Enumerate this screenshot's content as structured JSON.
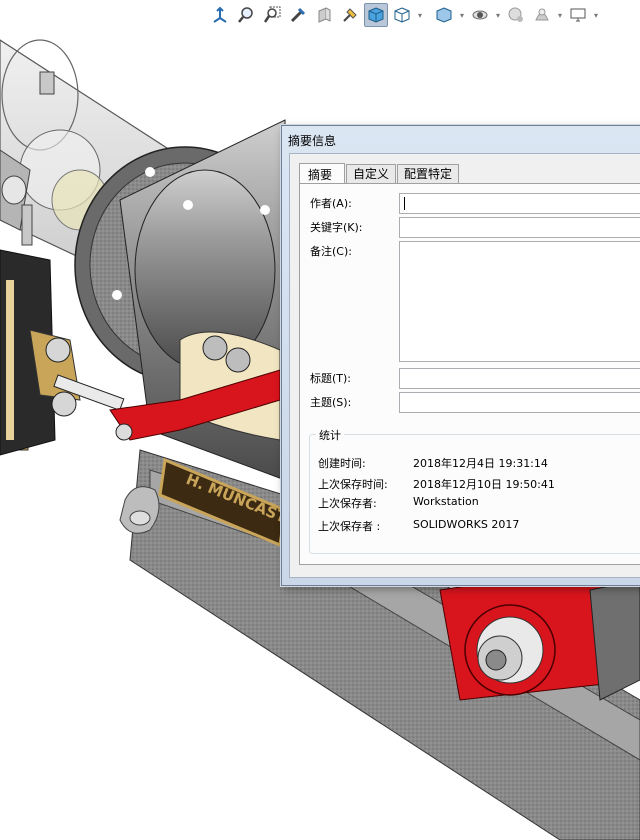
{
  "toolbar": {
    "buttons": [
      {
        "icon": "view-orientation-icon"
      },
      {
        "icon": "zoom-to-fit-icon"
      },
      {
        "icon": "zoom-to-area-icon"
      },
      {
        "icon": "previous-view-icon"
      },
      {
        "icon": "section-view-icon"
      },
      {
        "icon": "dynamic-annotation-icon"
      },
      {
        "icon": "shaded-display-icon",
        "active": true
      },
      {
        "icon": "display-style-icon"
      },
      {
        "icon": "hide-show-items-icon"
      },
      {
        "icon": "edit-appearance-icon"
      },
      {
        "icon": "apply-scene-icon"
      },
      {
        "icon": "view-settings-icon"
      },
      {
        "icon": "display-pane-icon"
      }
    ]
  },
  "dialog": {
    "title": "摘要信息",
    "tabs": [
      "摘要",
      "自定义",
      "配置特定"
    ],
    "active_tab": 0,
    "fields": {
      "author_label": "作者(A):",
      "author_value": "",
      "keywords_label": "关键字(K):",
      "keywords_value": "",
      "comments_label": "备注(C):",
      "comments_value": "",
      "title_label": "标题(T):",
      "title_value": "",
      "subject_label": "主题(S):",
      "subject_value": ""
    },
    "stats": {
      "legend": "统计",
      "rows": [
        {
          "label": "创建时间:",
          "value": "2018年12月4日 19:31:14"
        },
        {
          "label": "上次保存时间:",
          "value": "2018年12月10日 19:50:41"
        },
        {
          "label": "上次保存者:",
          "value": "Workstation"
        },
        {
          "label": "上次保存者 :",
          "value": "SOLIDWORKS 2017"
        }
      ]
    }
  },
  "model": {
    "nameplate_text": "H. MUNCAST"
  },
  "colors": {
    "accent_red": "#d8141c",
    "housing_grey": "#8f8f8f",
    "brass": "#c9a55a",
    "dialog_bg": "#f0f0f0"
  }
}
